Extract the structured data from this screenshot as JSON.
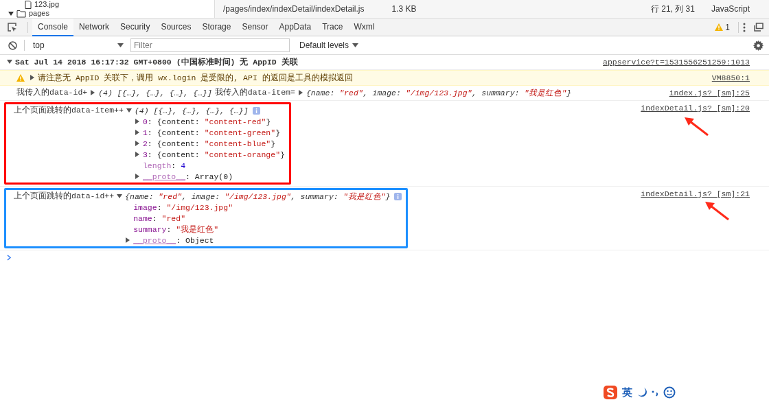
{
  "file_bar": {
    "tree": [
      {
        "kind": "file",
        "label": "123.jpg"
      },
      {
        "kind": "folder",
        "label": "pages",
        "expanded": true
      }
    ],
    "path": "/pages/index/indexDetail/indexDetail.js",
    "size": "1.3 KB",
    "cursor": "行 21, 列 31",
    "language": "JavaScript"
  },
  "tabs": [
    {
      "label": "Console",
      "selected": true
    },
    {
      "label": "Network",
      "selected": false
    },
    {
      "label": "Security",
      "selected": false
    },
    {
      "label": "Sources",
      "selected": false
    },
    {
      "label": "Storage",
      "selected": false
    },
    {
      "label": "Sensor",
      "selected": false
    },
    {
      "label": "AppData",
      "selected": false
    },
    {
      "label": "Trace",
      "selected": false
    },
    {
      "label": "Wxml",
      "selected": false
    }
  ],
  "warning_count": "1",
  "toolbar": {
    "context": "top",
    "filter_placeholder": "Filter",
    "levels": "Default levels"
  },
  "entries": [
    {
      "kind": "group",
      "expanded": true,
      "text": "Sat Jul 14 2018 16:17:32 GMT+0800 (中国标准时间) 无 AppID 关联",
      "source": "appservice?t=1531556251259:1013"
    },
    {
      "kind": "warning",
      "expanded": false,
      "text": "请注意无 AppID 关联下，调用 wx.login 是受限的, API 的返回是工具的模拟返回",
      "source": "VM8850:1"
    },
    {
      "kind": "log",
      "source": "index.js? [sm]:25",
      "parts": [
        {
          "label": "我传入的data-id+",
          "expanded": false,
          "preview": [
            {
              "kind": "punct",
              "text": "(4) [{…}, {…}, {…}, {…}]"
            }
          ]
        },
        {
          "label": "我传入的data-item=",
          "expanded": false,
          "preview": [
            {
              "kind": "punct",
              "text": "{name: "
            },
            {
              "kind": "string",
              "text": "\"red\""
            },
            {
              "kind": "punct",
              "text": ", image: "
            },
            {
              "kind": "string",
              "text": "\"/img/123.jpg\""
            },
            {
              "kind": "punct",
              "text": ", summary: "
            },
            {
              "kind": "string",
              "text": "\"我是红色\""
            },
            {
              "kind": "punct",
              "text": "}"
            }
          ]
        }
      ]
    },
    {
      "kind": "log",
      "source": "indexDetail.js? [sm]:20",
      "color": "#ff0000",
      "arrow": true,
      "parts": [
        {
          "label": "上个页面跳转的data-item++",
          "expanded": true,
          "info": true,
          "preview": [
            {
              "kind": "punct",
              "text": "(4) [{…}, {…}, {…}, {…}]"
            }
          ],
          "children": [
            {
              "toggle": true,
              "tokens": [
                {
                  "kind": "key",
                  "text": "0"
                },
                {
                  "kind": "plain",
                  "text": ": {content: "
                },
                {
                  "kind": "string",
                  "text": "\"content-red\""
                },
                {
                  "kind": "plain",
                  "text": "}"
                }
              ]
            },
            {
              "toggle": true,
              "tokens": [
                {
                  "kind": "key",
                  "text": "1"
                },
                {
                  "kind": "plain",
                  "text": ": {content: "
                },
                {
                  "kind": "string",
                  "text": "\"content-green\""
                },
                {
                  "kind": "plain",
                  "text": "}"
                }
              ]
            },
            {
              "toggle": true,
              "tokens": [
                {
                  "kind": "key",
                  "text": "2"
                },
                {
                  "kind": "plain",
                  "text": ": {content: "
                },
                {
                  "kind": "string",
                  "text": "\"content-blue\""
                },
                {
                  "kind": "plain",
                  "text": "}"
                }
              ]
            },
            {
              "toggle": true,
              "tokens": [
                {
                  "kind": "key",
                  "text": "3"
                },
                {
                  "kind": "plain",
                  "text": ": {content: "
                },
                {
                  "kind": "string",
                  "text": "\"content-orange\""
                },
                {
                  "kind": "plain",
                  "text": "}"
                }
              ]
            },
            {
              "toggle": false,
              "tokens": [
                {
                  "kind": "dimkey",
                  "text": "length"
                },
                {
                  "kind": "plain",
                  "text": ": "
                },
                {
                  "kind": "number",
                  "text": "4"
                }
              ]
            },
            {
              "toggle": true,
              "tokens": [
                {
                  "kind": "internal",
                  "text": "__proto__"
                },
                {
                  "kind": "plain",
                  "text": ": Array(0)"
                }
              ]
            }
          ]
        }
      ]
    },
    {
      "kind": "log",
      "source": "indexDetail.js? [sm]:21",
      "color": "#1e90ff",
      "arrow": true,
      "parts": [
        {
          "label": "上个页面跳转的data-id++",
          "expanded": true,
          "info": true,
          "preview": [
            {
              "kind": "punct",
              "text": "{name: "
            },
            {
              "kind": "string",
              "text": "\"red\""
            },
            {
              "kind": "punct",
              "text": ", image: "
            },
            {
              "kind": "string",
              "text": "\"/img/123.jpg\""
            },
            {
              "kind": "punct",
              "text": ", summary: "
            },
            {
              "kind": "string",
              "text": "\"我是红色\""
            },
            {
              "kind": "punct",
              "text": "}"
            }
          ],
          "children": [
            {
              "toggle": false,
              "tokens": [
                {
                  "kind": "key",
                  "text": "image"
                },
                {
                  "kind": "plain",
                  "text": ": "
                },
                {
                  "kind": "string",
                  "text": "\"/img/123.jpg\""
                }
              ]
            },
            {
              "toggle": false,
              "tokens": [
                {
                  "kind": "key",
                  "text": "name"
                },
                {
                  "kind": "plain",
                  "text": ": "
                },
                {
                  "kind": "string",
                  "text": "\"red\""
                }
              ]
            },
            {
              "toggle": false,
              "tokens": [
                {
                  "kind": "key",
                  "text": "summary"
                },
                {
                  "kind": "plain",
                  "text": ": "
                },
                {
                  "kind": "string",
                  "text": "\"我是红色\""
                }
              ]
            },
            {
              "toggle": true,
              "tokens": [
                {
                  "kind": "internal",
                  "text": "__proto__"
                },
                {
                  "kind": "plain",
                  "text": ": Object"
                }
              ]
            }
          ]
        }
      ]
    }
  ],
  "ime_bar": {
    "mode": "英"
  }
}
